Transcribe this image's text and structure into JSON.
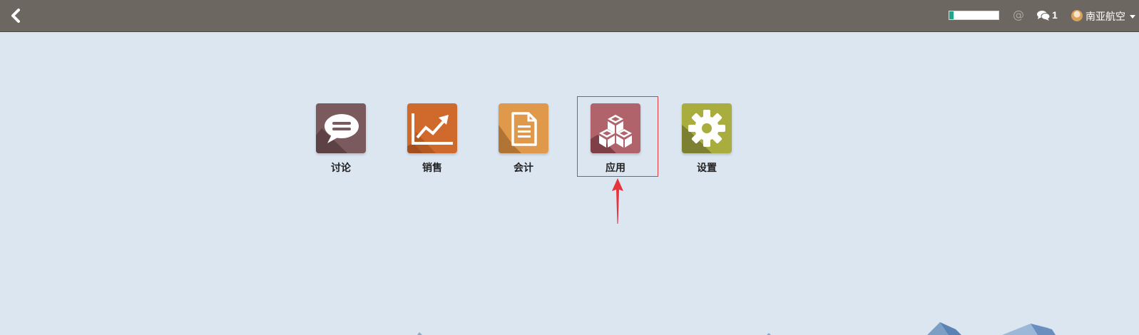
{
  "topbar": {
    "back_label": "back",
    "progress_fraction": 0.08,
    "at_symbol": "@",
    "message_count": "1",
    "user_name": "南亚航空"
  },
  "apps": [
    {
      "label": "讨论",
      "icon": "chat-bubble-icon",
      "color": "#7a5a5c"
    },
    {
      "label": "销售",
      "icon": "trend-chart-icon",
      "color": "#d06a2c"
    },
    {
      "label": "会计",
      "icon": "document-icon",
      "color": "#e0994a"
    },
    {
      "label": "应用",
      "icon": "cubes-icon",
      "color": "#b0636a"
    },
    {
      "label": "设置",
      "icon": "gear-icon",
      "color": "#a8ad3e"
    }
  ],
  "annotation": {
    "highlight_color": "#e23b3b",
    "highlighted_app": "应用"
  },
  "colors": {
    "topbar": "#6c6760",
    "background": "#dbe6f1"
  }
}
